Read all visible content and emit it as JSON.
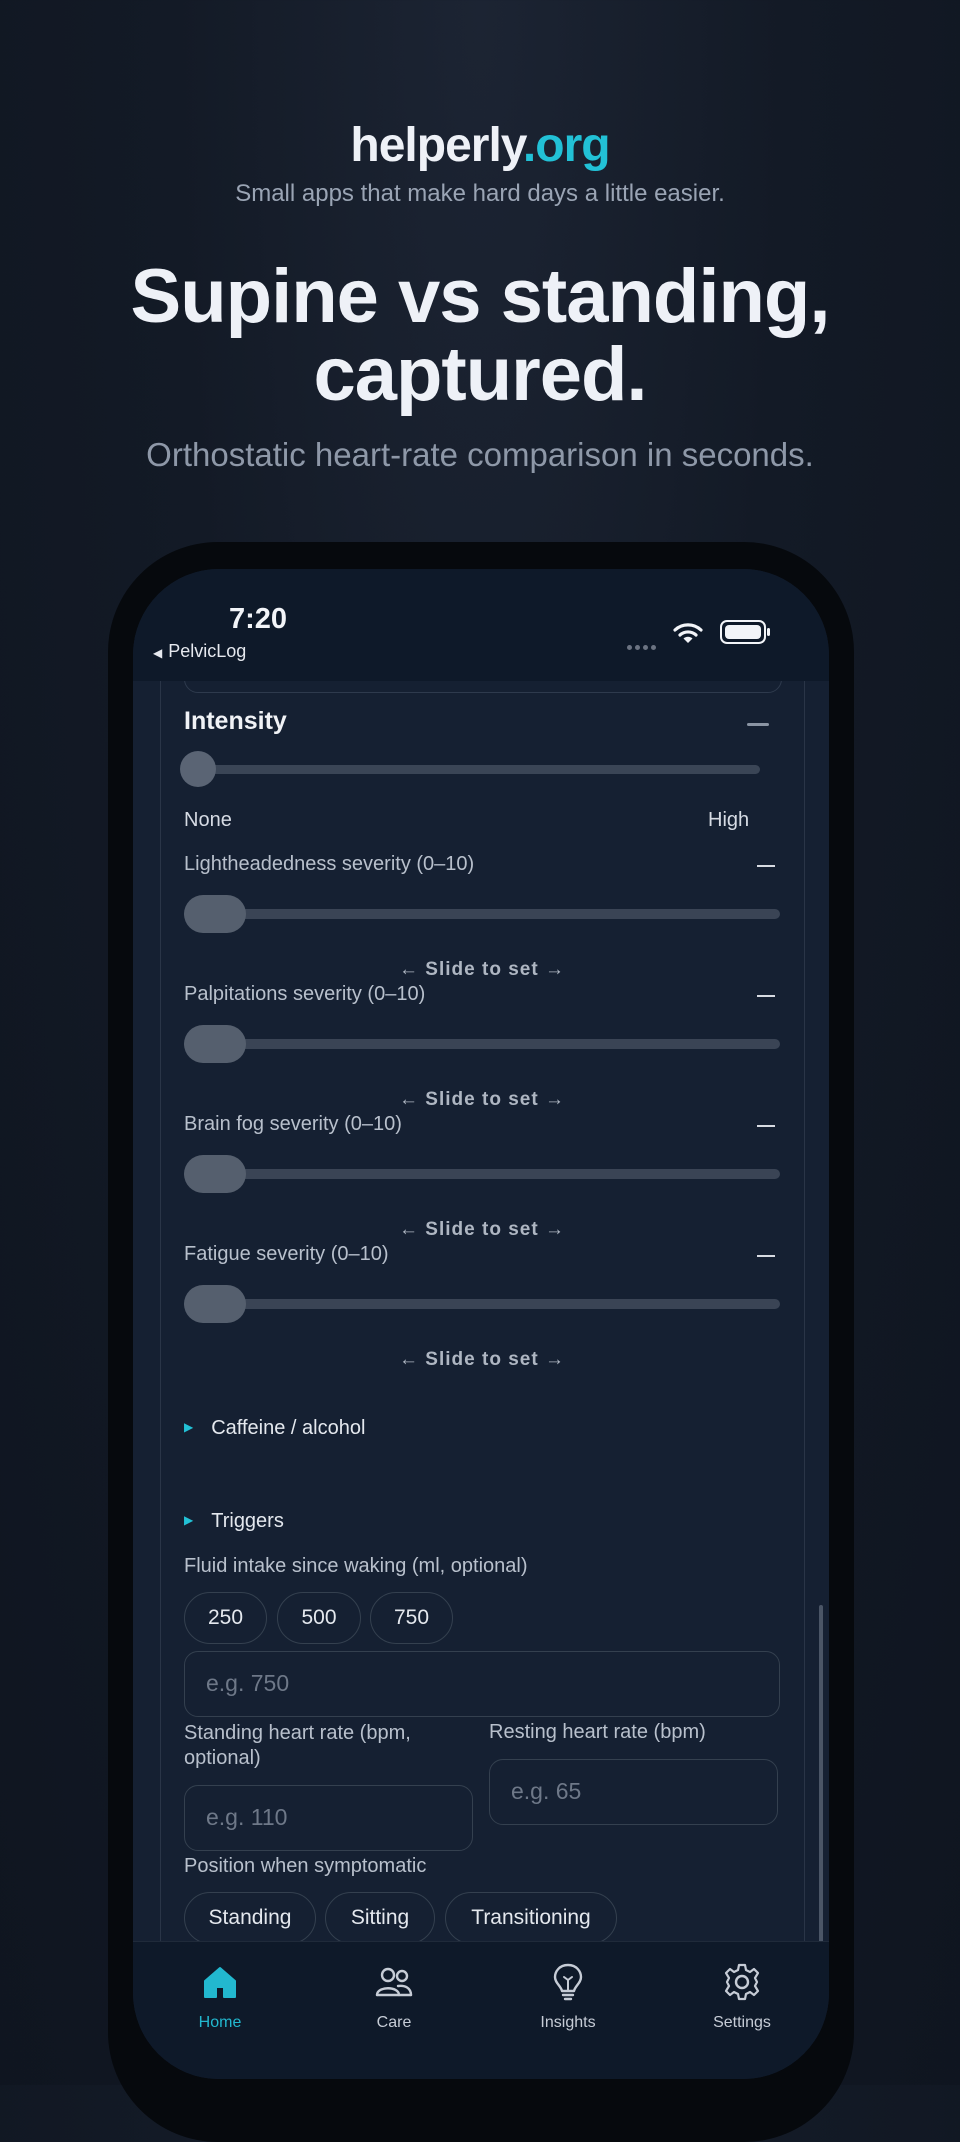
{
  "promo": {
    "brand_name": "helperly",
    "brand_tld": ".org",
    "tagline": "Small apps that make hard days a little easier.",
    "headline_line1": "Supine vs standing,",
    "headline_line2": "captured.",
    "subhead": "Orthostatic heart-rate comparison in seconds."
  },
  "status_bar": {
    "time": "7:20",
    "back_label": "PelvicLog"
  },
  "form": {
    "intensity": {
      "title": "Intensity",
      "min_label": "None",
      "max_label": "High",
      "value": null
    },
    "severities": [
      {
        "label": "Lightheadedness severity (0–10)",
        "hint": "← Slide to set →"
      },
      {
        "label": "Palpitations severity (0–10)",
        "hint": "← Slide to set →"
      },
      {
        "label": "Brain fog severity (0–10)",
        "hint": "← Slide to set →"
      },
      {
        "label": "Fatigue severity (0–10)",
        "hint": "← Slide to set →"
      }
    ],
    "sections": {
      "caffeine": "Caffeine / alcohol",
      "triggers": "Triggers"
    },
    "fluid": {
      "label": "Fluid intake since waking (ml, optional)",
      "chips": [
        "250",
        "500",
        "750"
      ],
      "placeholder": "e.g. 750"
    },
    "standing_hr": {
      "label": "Standing heart rate (bpm, optional)",
      "placeholder": "e.g. 110"
    },
    "resting_hr": {
      "label": "Resting heart rate (bpm)",
      "placeholder": "e.g. 65"
    },
    "position": {
      "label": "Position when symptomatic",
      "chips": [
        "Standing",
        "Sitting",
        "Transitioning"
      ]
    }
  },
  "tabbar": {
    "items": [
      {
        "label": "Home",
        "icon": "home-icon",
        "active": true
      },
      {
        "label": "Care",
        "icon": "people-icon"
      },
      {
        "label": "Insights",
        "icon": "lightbulb-icon"
      },
      {
        "label": "Settings",
        "icon": "gear-icon"
      }
    ]
  },
  "colors": {
    "accent": "#22c1d6",
    "background": "#131a26",
    "screen": "#152032"
  }
}
